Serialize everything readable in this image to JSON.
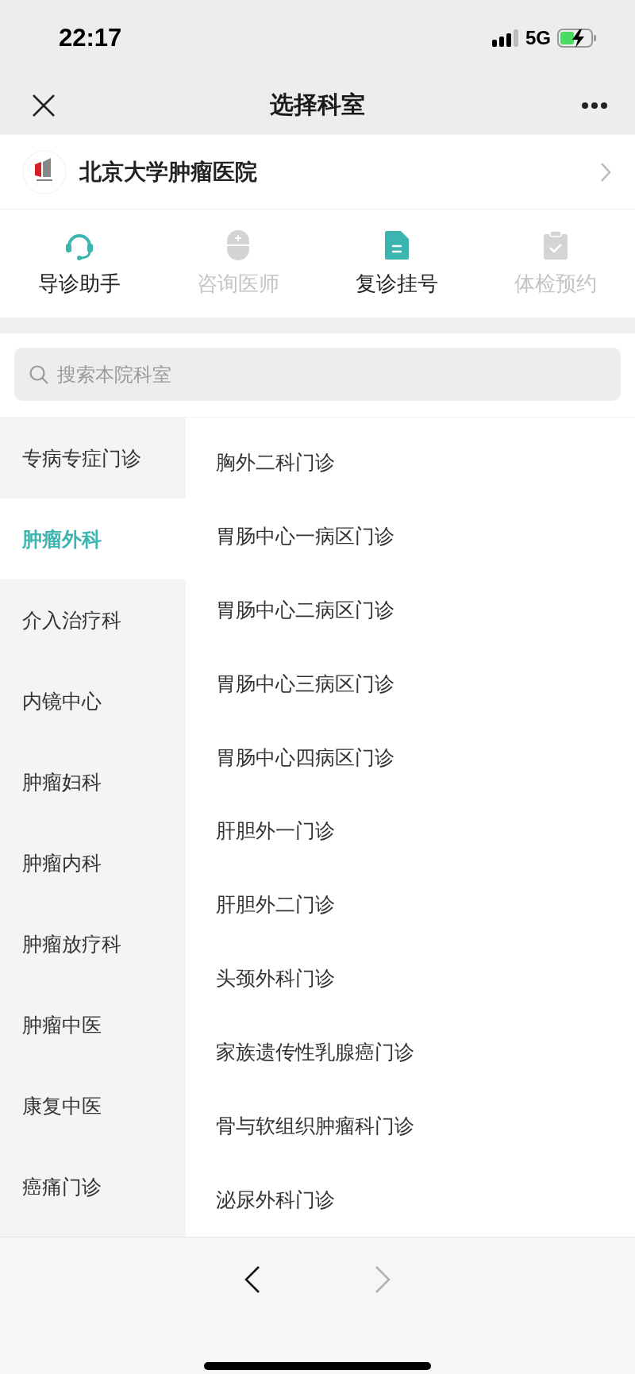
{
  "status_bar": {
    "time": "22:17",
    "network": "5G"
  },
  "nav_bar": {
    "title": "选择科室"
  },
  "hospital": {
    "name": "北京大学肿瘤医院"
  },
  "services": [
    {
      "kind": "headset",
      "label": "导诊助手",
      "disabled": false
    },
    {
      "kind": "doctor",
      "label": "咨询医师",
      "disabled": true
    },
    {
      "kind": "document",
      "label": "复诊挂号",
      "disabled": false
    },
    {
      "kind": "clipboard",
      "label": "体检预约",
      "disabled": true
    }
  ],
  "search": {
    "placeholder": "搜索本院科室"
  },
  "categories": [
    {
      "label": "专病专症门诊",
      "selected": false
    },
    {
      "label": "肿瘤外科",
      "selected": true
    },
    {
      "label": "介入治疗科",
      "selected": false
    },
    {
      "label": "内镜中心",
      "selected": false
    },
    {
      "label": "肿瘤妇科",
      "selected": false
    },
    {
      "label": "肿瘤内科",
      "selected": false
    },
    {
      "label": "肿瘤放疗科",
      "selected": false
    },
    {
      "label": "肿瘤中医",
      "selected": false
    },
    {
      "label": "康复中医",
      "selected": false
    },
    {
      "label": "癌痛门诊",
      "selected": false
    }
  ],
  "departments": [
    "胸外二科门诊",
    "胃肠中心一病区门诊",
    "胃肠中心二病区门诊",
    "胃肠中心三病区门诊",
    "胃肠中心四病区门诊",
    "肝胆外一门诊",
    "肝胆外二门诊",
    "头颈外科门诊",
    "家族遗传性乳腺癌门诊",
    "骨与软组织肿瘤科门诊",
    "泌尿外科门诊"
  ],
  "browser_nav": {
    "back_disabled": false,
    "forward_disabled": true
  }
}
